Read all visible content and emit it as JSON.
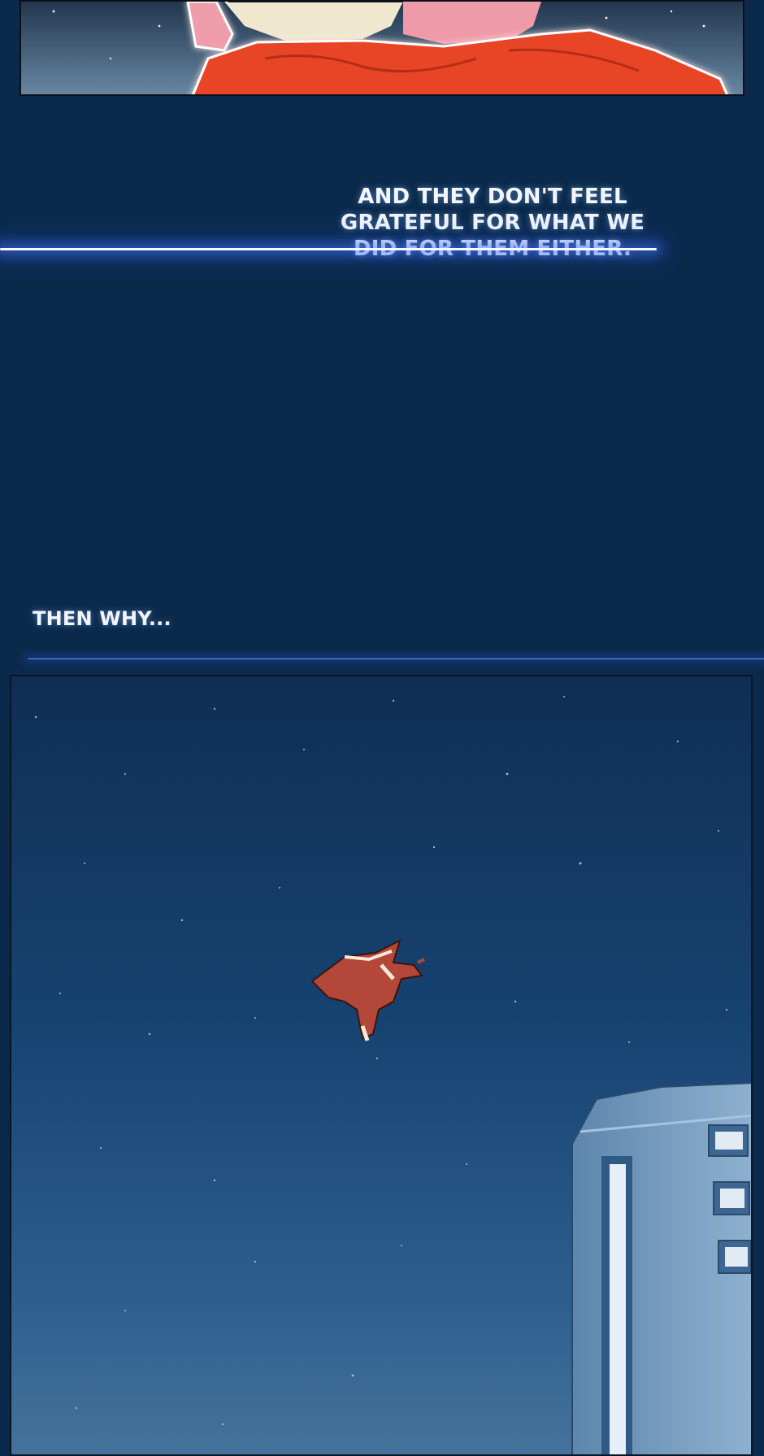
{
  "captions": {
    "line_1": "AND THEY DON'T FEEL GRATEFUL FOR WHAT WE DID FOR THEM EITHER.",
    "line_2": "THEN WHY..."
  },
  "colors": {
    "background": "#0b2a4b",
    "caption_text": "#f3f6ff",
    "caption_glow": "#3e6cff",
    "scarf": "#e84525",
    "hair": "#ee9aa8",
    "building": "#7da4c8",
    "figure_robe": "#b2473a"
  },
  "icons": {
    "panel_1": "character-closeup-illustration",
    "panel_2": "night-sky-flying-figure-illustration"
  }
}
